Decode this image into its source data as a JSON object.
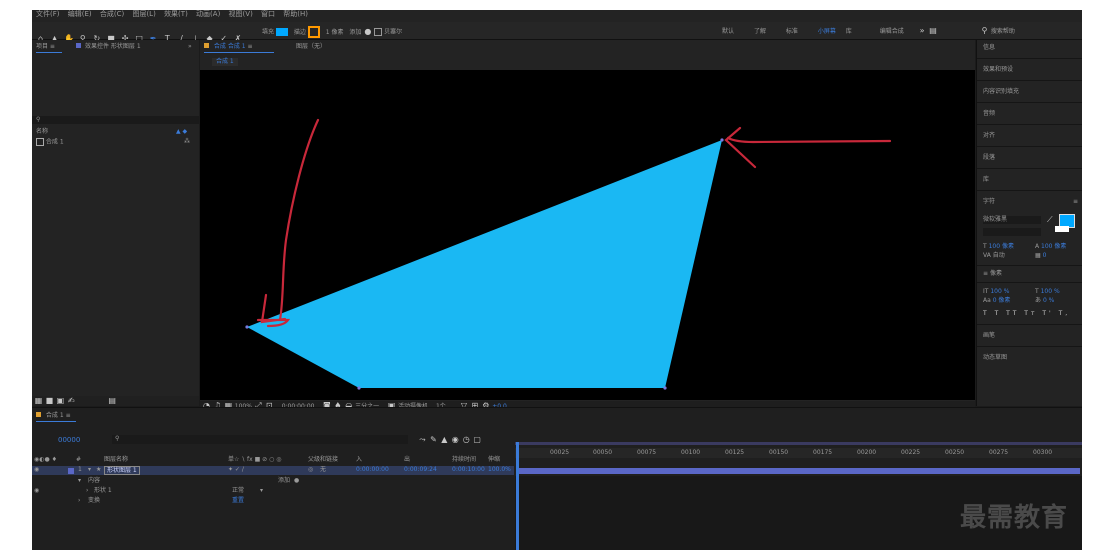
{
  "menubar": {
    "items": [
      "文件(F)",
      "编辑(E)",
      "合成(C)",
      "图层(L)",
      "效果(T)",
      "动画(A)",
      "视图(V)",
      "窗口",
      "帮助(H)"
    ]
  },
  "toolbar": {
    "tool_icons": [
      "home-icon",
      "selection-icon",
      "hand-icon",
      "zoom-icon",
      "rotate-icon",
      "camera-icon",
      "pan-behind-icon",
      "rectangle-icon",
      "pen-icon",
      "type-icon",
      "brush-icon",
      "clone-stamp-icon",
      "eraser-icon",
      "roto-brush-icon",
      "puppet-pin-icon"
    ],
    "fill_label": "填充",
    "stroke_label": "描边",
    "stroke_width": "1 像素",
    "add_label": "添加",
    "bezier_label": "贝塞尔",
    "workspaces": [
      "默认",
      "了解",
      "标准",
      "小屏幕",
      "库",
      "",
      "编辑合成"
    ],
    "active_workspace": "小屏幕",
    "search_placeholder": "搜索帮助",
    "fill_color": "#00a8ff",
    "stroke_color": "#ff9900"
  },
  "project": {
    "tab_label": "项目",
    "effects_tab": "效果控件 形状图层 1",
    "search_icon": "search-icon",
    "column_name": "名称",
    "item_label": "合成 1"
  },
  "comp": {
    "tab_label": "合成 合成 1",
    "layer_tab": "图层（无）",
    "breadcrumb": "合成 1",
    "zoom": "100%",
    "time": "0:00:00:00",
    "resolution": "三分之一",
    "camera": "活动摄像机",
    "views": "1个...",
    "offset": "+0.0",
    "shape_fill": "#1ab8f3",
    "annotation_color": "#d32a3a"
  },
  "right_panel": {
    "items": [
      "信息",
      "音频",
      "预览",
      "效果和预设",
      "对齐",
      "库",
      "字符",
      "段落",
      "跟踪器",
      "内容识别填充",
      "画笔",
      "动态草图"
    ],
    "char_font": "微软雅黑",
    "char_size": "100 像素",
    "char_leading": "自动",
    "char_unit": "像素",
    "char_scale_v": "100 %",
    "char_scale_h": "100 %",
    "char_baseline": "0 像素",
    "char_tsume": "0 %",
    "swatch_color": "#00a8ff"
  },
  "timeline": {
    "tab_label": "合成 1",
    "timecode": "00000",
    "header_cols": [
      "#",
      "图层名称",
      "单☆ ∖ fx ■ ⊘ ○ ◎",
      "父级和链接",
      "入",
      "出",
      "持续时间",
      "伸缩"
    ],
    "layer_number": "1",
    "layer_name": "形状图层 1",
    "parent_value": "无",
    "in_value": "0:00:00:00",
    "out_value": "0:00:09:24",
    "duration_value": "0:00:10:00",
    "stretch_value": "100.0%",
    "contents_label": "内容",
    "add_label": "添加",
    "shape_label": "形状 1",
    "blend_label": "正常",
    "transform_label": "变换",
    "reset_label": "重置",
    "ruler_ticks": [
      "00025",
      "00050",
      "00075",
      "00100",
      "00125",
      "00150",
      "00175",
      "00200",
      "00225",
      "00250",
      "00275",
      "00300"
    ]
  },
  "watermark": "最需教育"
}
